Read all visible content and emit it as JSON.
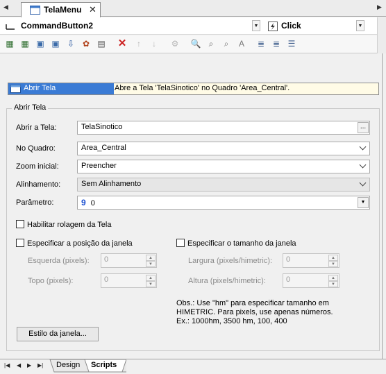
{
  "tabbar": {
    "doc_title": "TelaMenu",
    "close": "✕",
    "nav_left": "◀",
    "nav_right": "▶"
  },
  "combos": {
    "object": "CommandButton2",
    "event": "Click"
  },
  "event_row": {
    "name": "Abrir Tela",
    "description": "Abre a Tela 'TelaSinotico' no Quadro 'Area_Central'."
  },
  "group": {
    "title": "Abrir Tela"
  },
  "form": {
    "abrir_label": "Abrir a Tela:",
    "abrir_value": "TelaSinotico",
    "ellipsis": "...",
    "quadro_label": "No Quadro:",
    "quadro_value": "Area_Central",
    "zoom_label": "Zoom inicial:",
    "zoom_value": "Preencher",
    "alinhamento_label": "Alinhamento:",
    "alinhamento_value": "Sem Alinhamento",
    "parametro_label": "Parâmetro:",
    "parametro_icon": "9",
    "parametro_value": "0"
  },
  "checks": {
    "rolagem": "Habilitar rolagem da Tela",
    "posicao": "Especificar a posição da janela",
    "tamanho": "Especificar o tamanho da janela"
  },
  "position": {
    "esquerda_label": "Esquerda (pixels):",
    "esquerda_value": "0",
    "topo_label": "Topo (pixels):",
    "topo_value": "0"
  },
  "size": {
    "largura_label": "Largura (pixels/himetric):",
    "largura_value": "0",
    "altura_label": "Altura (pixels/himetric):",
    "altura_value": "0"
  },
  "note": {
    "line1": "Obs.: Use \"hm\" para especificar tamanho em",
    "line2": "HIMETRIC. Para pixels, use apenas números.",
    "line3": "Ex.: 1000hm, 3500 hm, 100, 400"
  },
  "style_button": "Estilo da janela...",
  "bottom_tabs": {
    "design": "Design",
    "scripts": "Scripts"
  },
  "colors": {
    "selection": "#3a7bd5",
    "delete": "#cc1f1f",
    "param_icon": "#1a4fd0"
  }
}
